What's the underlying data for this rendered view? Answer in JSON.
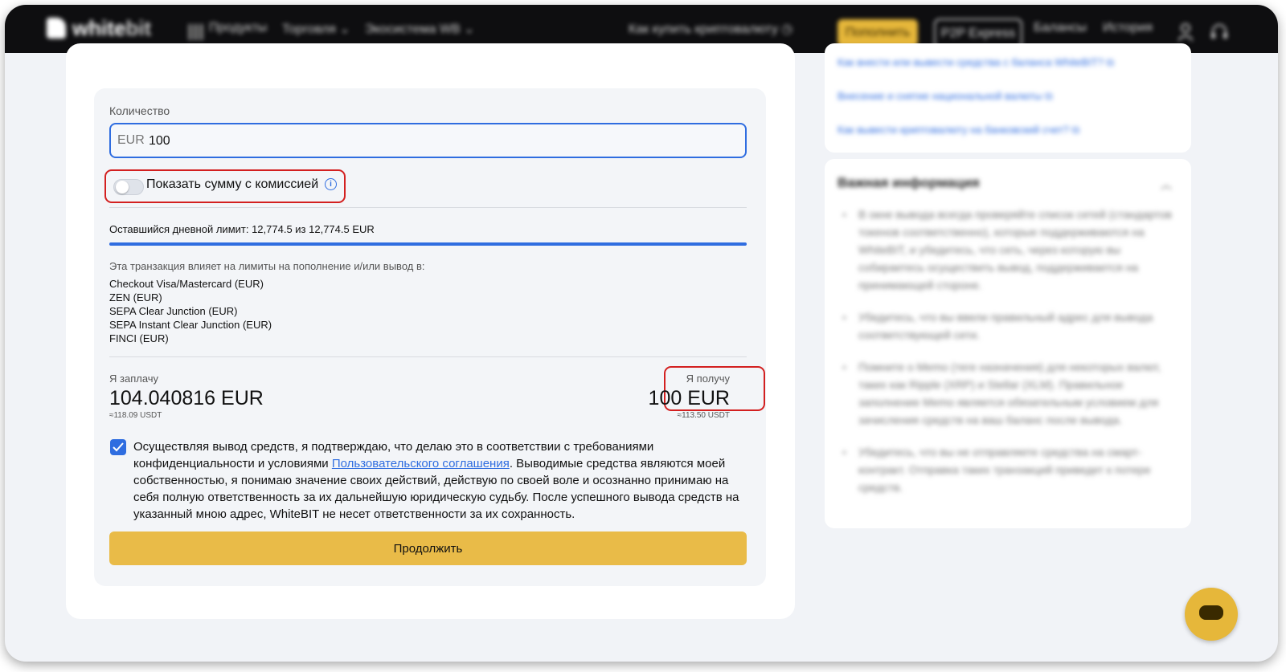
{
  "nav": {
    "logo_white": "white",
    "logo_bit": "bit",
    "items": [
      "Продукты",
      "Торговля",
      "Экосистема WB",
      "Как купить криптовалюту"
    ],
    "deposit_button": "Пополнить",
    "p2p_button": "P2P Express",
    "balances": "Балансы",
    "history": "История"
  },
  "form": {
    "quantity_label": "Количество",
    "currency": "EUR",
    "amount_value": "100",
    "toggle_label": "Показать сумму с комиссией",
    "toggle_on": false,
    "limit_text": "Оставшийся дневной лимит: 12,774.5 из 12,774.5 EUR",
    "limit_fraction": 1.0,
    "affects_title": "Эта транзакция влияет на лимиты на пополнение и/или вывод в:",
    "methods": [
      "Checkout Visa/Mastercard (EUR)",
      "ZEN (EUR)",
      "SEPA Clear Junction (EUR)",
      "SEPA Instant Clear Junction (EUR)",
      "FINCI (EUR)"
    ],
    "pay_label": "Я заплачу",
    "pay_amount": "104.040816 EUR",
    "pay_usdt": "≈118.09 USDT",
    "receive_label": "Я получу",
    "receive_amount": "100 EUR",
    "receive_usdt": "≈113.50 USDT",
    "consent_checked": true,
    "consent_before": "Осуществляя вывод средств, я подтверждаю, что делаю это в соответствии с требованиями конфиденциальности и условиями ",
    "consent_link": "Пользовательского соглашения",
    "consent_after": ". Выводимые средства являются моей собственностью, я понимаю значение своих действий, действую по своей воле и осознанно принимаю на себя полную ответственность за их дальнейшую юридическую судьбу. После успешного вывода средств на указанный мною адрес, WhiteBIT не несет ответственности за их сохранность.",
    "continue_button": "Продолжить"
  },
  "sidebar": {
    "links": [
      "Как внести или вывести средства с баланса WhiteBIT?",
      "Внесение и снятие национальной валюты",
      "Как вывести криптовалюту на банковский счет?"
    ],
    "important_title": "Важная информация",
    "important_items": [
      "В окне вывода всегда проверяйте список сетей (стандартов токенов соответственно), которые поддерживаются на WhiteBIT, и убедитесь, что сеть, через которую вы собираетесь осуществить вывод, поддерживается на принимающей стороне.",
      "Убедитесь, что вы ввели правильный адрес для вывода соответствующей сети.",
      "Помните о Memo (теге назначения) для некоторых валют, таких как Ripple (XRP) и Stellar (XLM). Правильное заполнение Memo является обязательным условием для зачисления средств на ваш баланс после вывода.",
      "Убедитесь, что вы не отправляете средства на смарт-контракт. Отправка таких транзакций приведет к потере средств."
    ]
  }
}
